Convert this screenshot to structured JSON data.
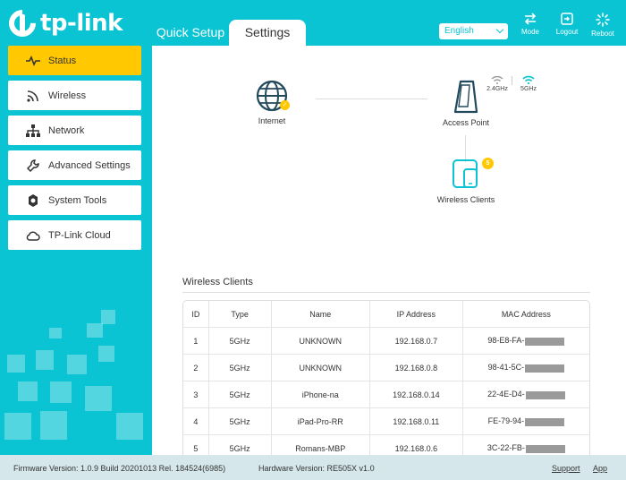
{
  "brand": {
    "name": "tp-link"
  },
  "tabs": [
    {
      "label": "Quick Setup",
      "active": false
    },
    {
      "label": "Settings",
      "active": true
    }
  ],
  "language": {
    "selected": "English"
  },
  "header_buttons": {
    "mode": "Mode",
    "logout": "Logout",
    "reboot": "Reboot"
  },
  "sidebar": {
    "items": [
      {
        "label": "Status",
        "icon": "pulse-icon",
        "active": true
      },
      {
        "label": "Wireless",
        "icon": "wifi-icon",
        "active": false
      },
      {
        "label": "Network",
        "icon": "network-icon",
        "active": false
      },
      {
        "label": "Advanced Settings",
        "icon": "wrench-icon",
        "active": false
      },
      {
        "label": "System Tools",
        "icon": "gear-icon",
        "active": false
      },
      {
        "label": "TP-Link Cloud",
        "icon": "cloud-icon",
        "active": false
      }
    ]
  },
  "topology": {
    "internet": {
      "label": "Internet",
      "status": "connected"
    },
    "access_point": {
      "label": "Access Point"
    },
    "bands": [
      {
        "label": "2.4GHz",
        "color": "#999999"
      },
      {
        "label": "5GHz",
        "color": "#0bc4d3"
      }
    ],
    "wireless_clients": {
      "label": "Wireless Clients",
      "count": "5"
    }
  },
  "clients_section": {
    "title": "Wireless Clients",
    "columns": [
      "ID",
      "Type",
      "Name",
      "IP Address",
      "MAC Address"
    ],
    "rows": [
      {
        "id": "1",
        "type": "5GHz",
        "name": "UNKNOWN",
        "ip": "192.168.0.7",
        "mac": "98-E8-FA-"
      },
      {
        "id": "2",
        "type": "5GHz",
        "name": "UNKNOWN",
        "ip": "192.168.0.8",
        "mac": "98-41-5C-"
      },
      {
        "id": "3",
        "type": "5GHz",
        "name": "iPhone-na",
        "ip": "192.168.0.14",
        "mac": "22-4E-D4-"
      },
      {
        "id": "4",
        "type": "5GHz",
        "name": "iPad-Pro-RR",
        "ip": "192.168.0.11",
        "mac": "FE-79-94-"
      },
      {
        "id": "5",
        "type": "5GHz",
        "name": "Romans-MBP",
        "ip": "192.168.0.6",
        "mac": "3C-22-FB-"
      }
    ]
  },
  "footer": {
    "firmware": "Firmware Version: 1.0.9 Build 20201013 Rel. 184524(6985)",
    "hardware": "Hardware Version: RE505X v1.0",
    "support": "Support",
    "app": "App"
  },
  "colors": {
    "brand": "#0bc4d3",
    "active_nav": "#ffc800",
    "footer_bg": "#d5e7ea"
  }
}
